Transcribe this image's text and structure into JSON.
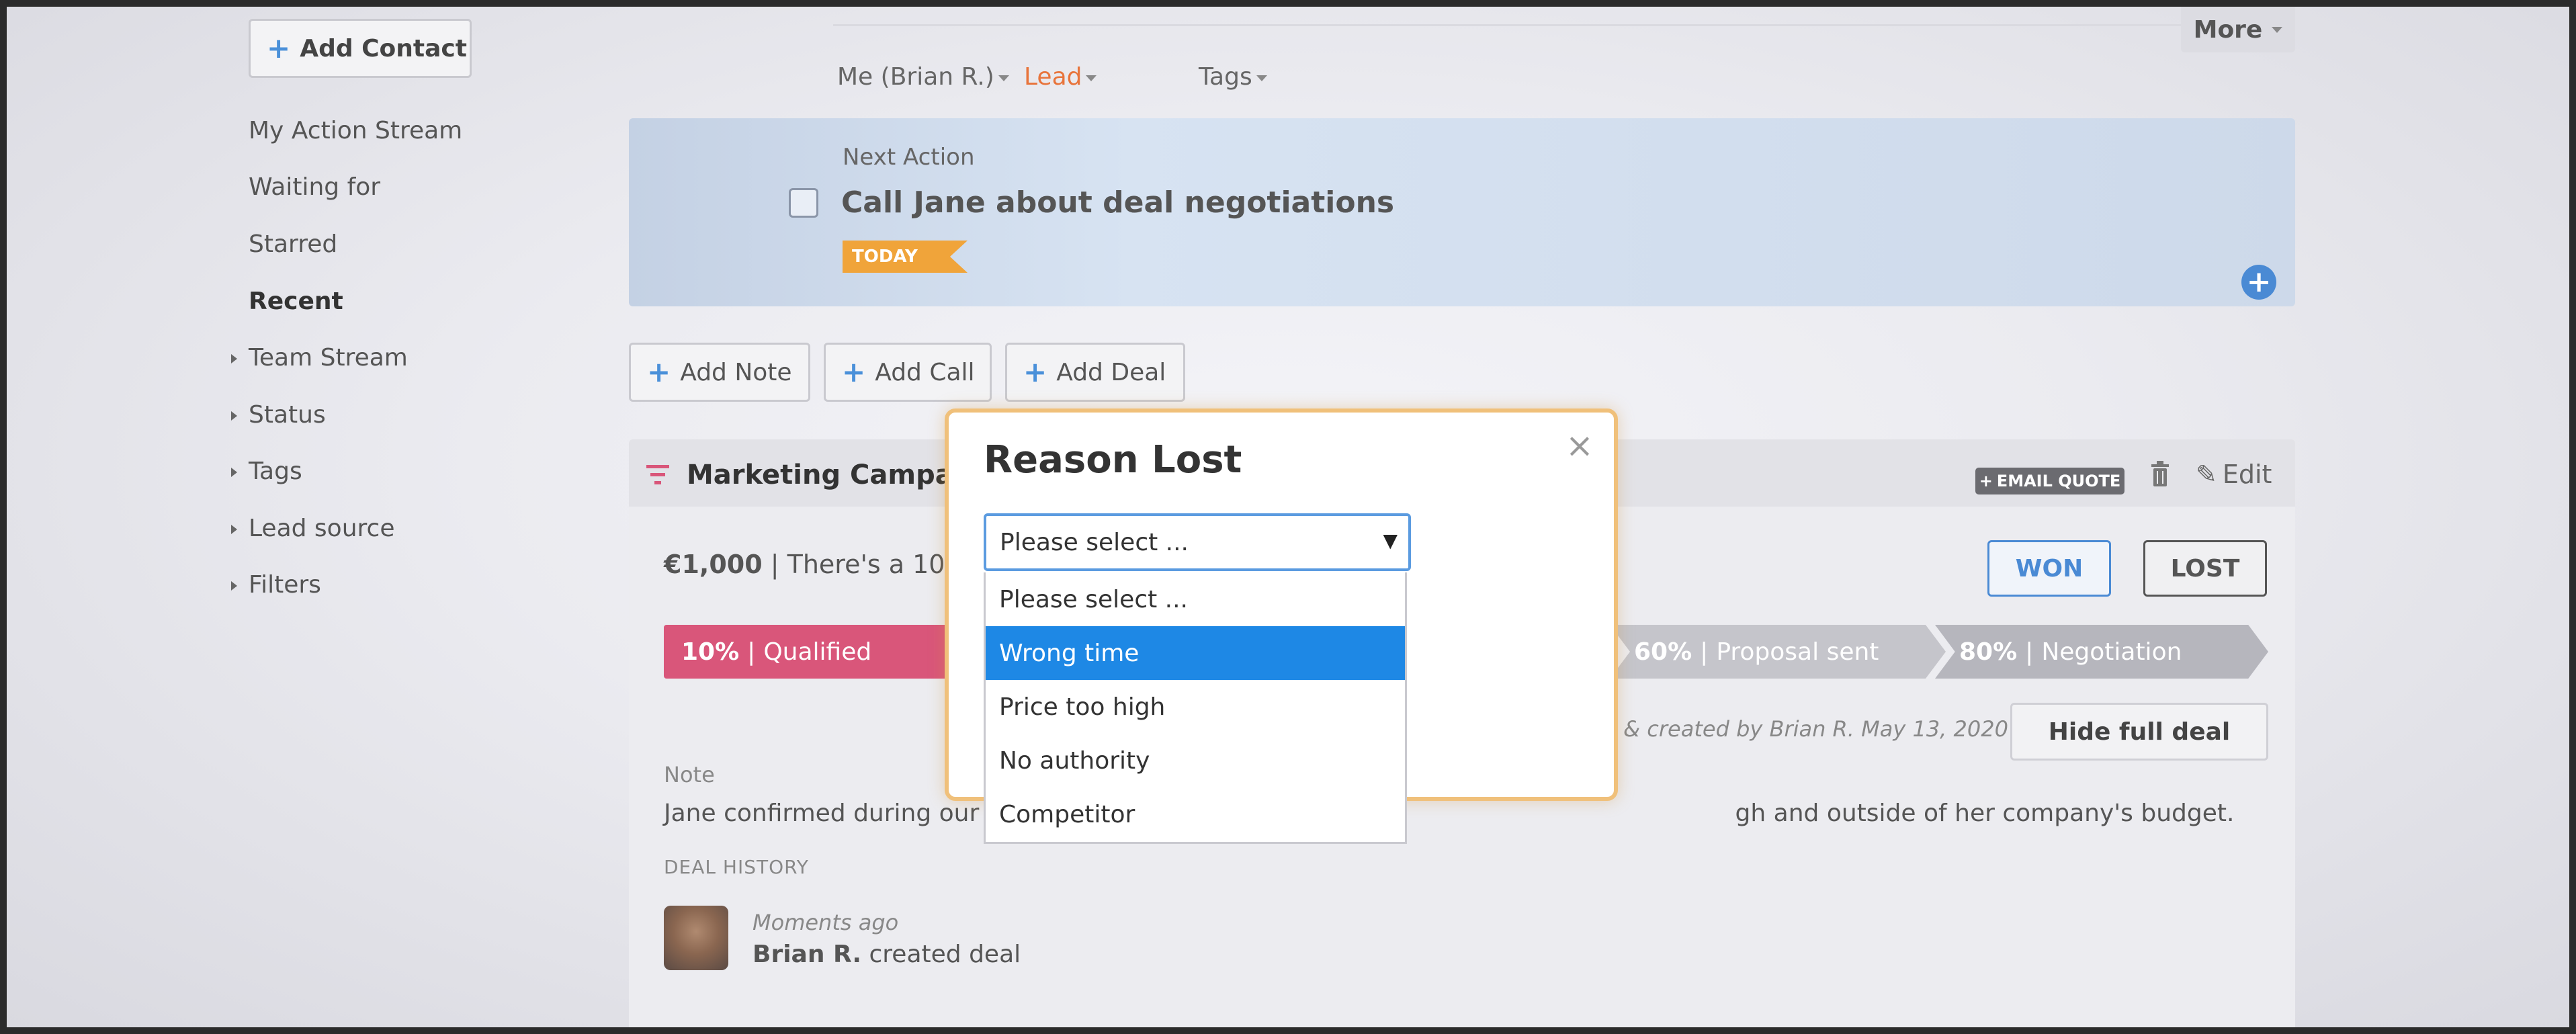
{
  "sidebar": {
    "add_contact": "Add Contact",
    "items": [
      {
        "label": "My Action Stream"
      },
      {
        "label": "Waiting for"
      },
      {
        "label": "Starred"
      },
      {
        "label": "Recent"
      },
      {
        "label": "Team Stream"
      },
      {
        "label": "Status"
      },
      {
        "label": "Tags"
      },
      {
        "label": "Lead source"
      },
      {
        "label": "Filters"
      }
    ]
  },
  "header": {
    "owner": "Me (Brian R.)",
    "status": "Lead",
    "tags": "Tags",
    "more": "More",
    "status_color": "#e8743b"
  },
  "next_action": {
    "label": "Next Action",
    "title": "Call Jane about deal negotiations",
    "badge": "TODAY"
  },
  "actions": {
    "add_note": "Add Note",
    "add_call": "Add Call",
    "add_deal": "Add Deal"
  },
  "deal": {
    "title": "Marketing Campaign",
    "email_quote": "EMAIL QUOTE",
    "edit": "Edit",
    "value": "€1,000",
    "probability_text": " | There's a 10%",
    "won": "WON",
    "lost": "LOST",
    "stages": [
      {
        "pct": "10%",
        "name": "Qualified"
      },
      {
        "pct": "60%",
        "name": "Proposal sent"
      },
      {
        "pct": "80%",
        "name": "Negotiation"
      }
    ],
    "created_info": "ed & created by Brian R. May 13, 2020",
    "hide_full_deal": "Hide full deal",
    "note_label": "Note",
    "note_text_start": "Jane confirmed during our c",
    "note_text_end": "gh and outside of her company's budget.",
    "history_label": "DEAL HISTORY",
    "history_time": "Moments ago",
    "history_user": "Brian R.",
    "history_action": " created deal"
  },
  "modal": {
    "title": "Reason Lost",
    "close": "×",
    "select_value": "Please select ...",
    "options": [
      {
        "label": "Please select ..."
      },
      {
        "label": "Wrong time"
      },
      {
        "label": "Price too high"
      },
      {
        "label": "No authority"
      },
      {
        "label": "Competitor"
      }
    ],
    "highlighted": "Wrong time"
  }
}
